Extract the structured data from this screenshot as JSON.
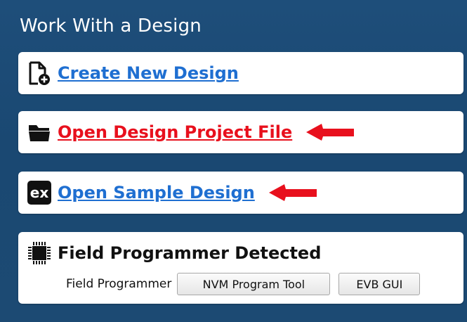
{
  "panel": {
    "title": "Work With a Design"
  },
  "cards": [
    {
      "label": "Create New Design",
      "icon": "new-document-icon",
      "highlighted": false
    },
    {
      "label": "Open Design Project File",
      "icon": "folder-icon",
      "highlighted": true
    },
    {
      "label": "Open Sample Design",
      "icon": "ex-icon",
      "highlighted": true,
      "icon_text": "ex"
    }
  ],
  "field_programmer": {
    "title": "Field Programmer Detected",
    "label": "Field Programmer",
    "buttons": [
      "NVM Program Tool",
      "EVB GUI"
    ]
  },
  "colors": {
    "panel_bg": "#1c4a73",
    "link": "#1f6fd1",
    "link_active": "#e8101d",
    "arrow": "#e8101d"
  }
}
